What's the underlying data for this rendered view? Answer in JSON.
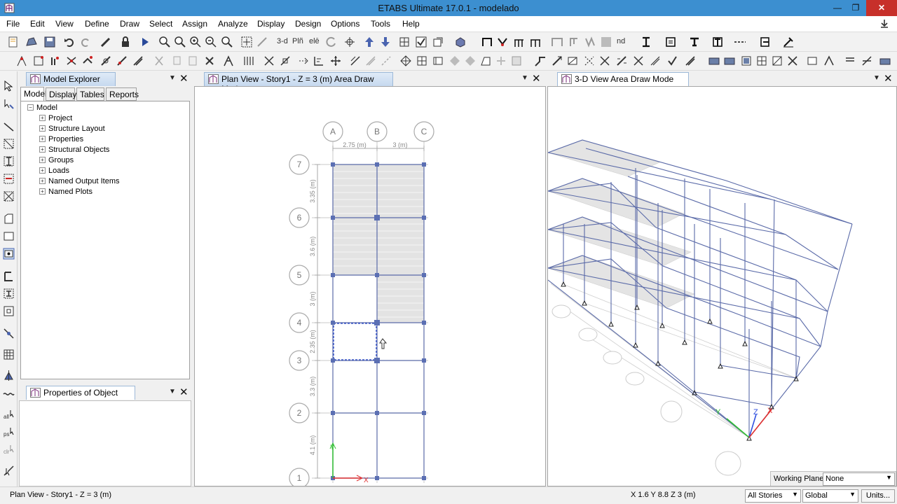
{
  "window": {
    "title": "ETABS Ultimate 17.0.1 - modelado",
    "min": "—",
    "restore": "❐",
    "close": "✕"
  },
  "menu": [
    "File",
    "Edit",
    "View",
    "Define",
    "Draw",
    "Select",
    "Assign",
    "Analyze",
    "Display",
    "Design",
    "Options",
    "Tools",
    "Help"
  ],
  "toolbar": {
    "view3d": "3-d",
    "plan": "Plñ",
    "elev": "elē",
    "nd": "nd"
  },
  "explorer": {
    "title": "Model Explorer",
    "tabs": [
      "Model",
      "Display",
      "Tables",
      "Reports"
    ],
    "root": "Model",
    "items": [
      "Project",
      "Structure Layout",
      "Properties",
      "Structural Objects",
      "Groups",
      "Loads",
      "Named Output Items",
      "Named Plots"
    ]
  },
  "properties_panel": {
    "title": "Properties of Object"
  },
  "plan_view": {
    "title": "Plan View - Story1 - Z = 3 (m)  Area Draw Mode",
    "grid_x": [
      "A",
      "B",
      "C"
    ],
    "grid_y": [
      "7",
      "6",
      "5",
      "4",
      "3",
      "2",
      "1"
    ],
    "dims_x": [
      "2.75 (m)",
      "3 (m)"
    ],
    "dims_y": [
      "3.35 (m)",
      "3.6 (m)",
      "3 (m)",
      "2.35 (m)",
      "3.3 (m)",
      "4.1 (m)"
    ]
  },
  "view_3d": {
    "title": "3-D View  Area Draw Mode"
  },
  "working_plane": {
    "label": "Working Plane",
    "value": "None"
  },
  "status": {
    "left": "Plan View - Story1 - Z = 3 (m)",
    "coords": "X 1.6  Y 8.8  Z 3 (m)",
    "stories": "All Stories",
    "coord_system": "Global",
    "units_button": "Units..."
  },
  "colors": {
    "titlebar": "#3c8fd0",
    "frame": "#5a6aa8",
    "joint": "#5b6fb3",
    "slab": "#e2e2e2",
    "axis_x": "#e03030",
    "axis_y": "#30c030",
    "axis_z": "#3050e0"
  }
}
